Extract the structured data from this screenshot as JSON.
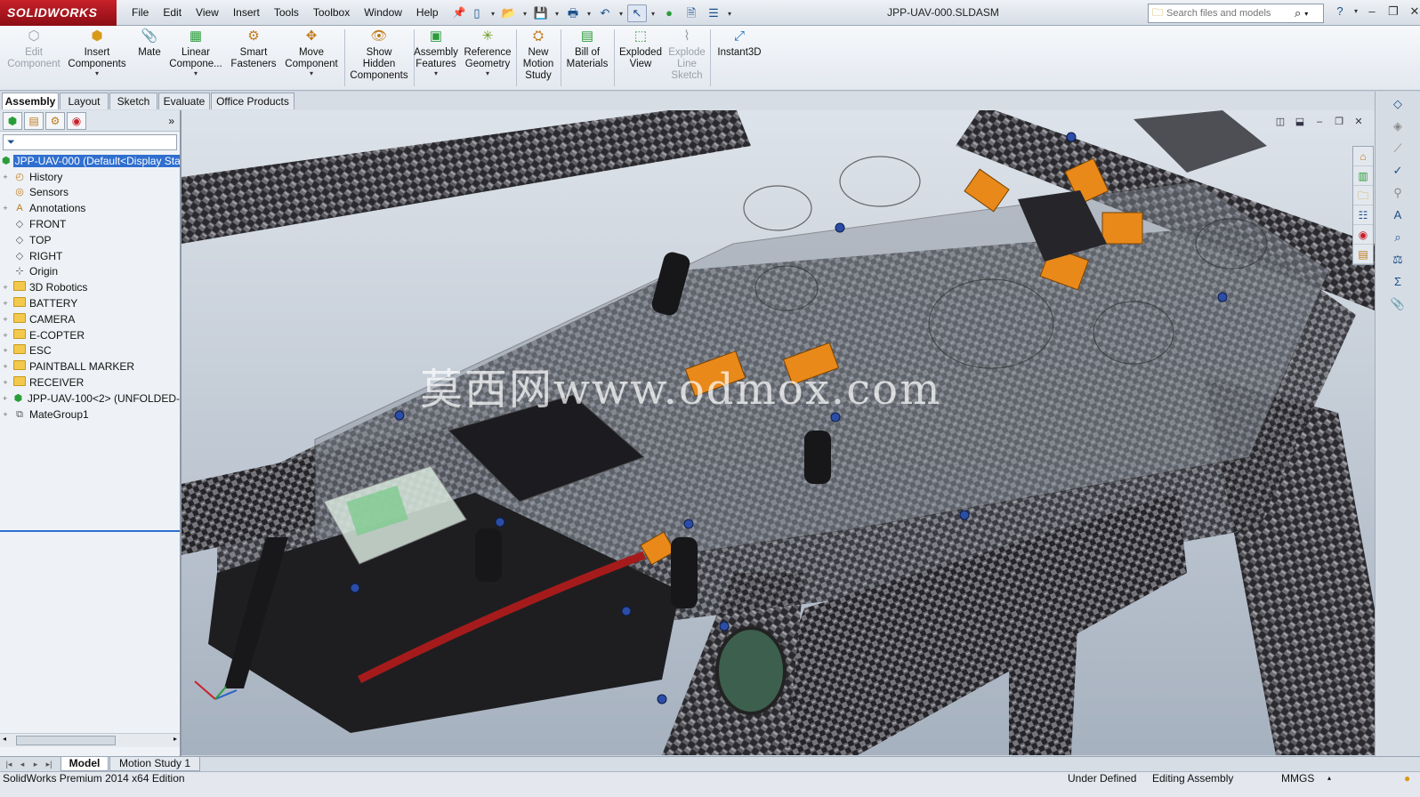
{
  "app": {
    "name": "SOLIDWORKS",
    "document_title": "JPP-UAV-000.SLDASM"
  },
  "menu": [
    "File",
    "Edit",
    "View",
    "Insert",
    "Tools",
    "Toolbox",
    "Window",
    "Help"
  ],
  "search": {
    "placeholder": "Search files and models"
  },
  "ribbon": {
    "edit_component": "Edit\nComponent",
    "insert_components": "Insert\nComponents",
    "mate": "Mate",
    "linear_component": "Linear\nCompone...",
    "smart_fasteners": "Smart\nFasteners",
    "move_component": "Move\nComponent",
    "show_hidden_components": "Show\nHidden\nComponents",
    "assembly_features": "Assembly\nFeatures",
    "reference_geometry": "Reference\nGeometry",
    "new_motion_study": "New\nMotion\nStudy",
    "bill_of_materials": "Bill of\nMaterials",
    "exploded_view": "Exploded\nView",
    "explode_line_sketch": "Explode\nLine\nSketch",
    "instant3d": "Instant3D"
  },
  "command_tabs": [
    "Assembly",
    "Layout",
    "Sketch",
    "Evaluate",
    "Office Products"
  ],
  "feature_tree": [
    {
      "label": "JPP-UAV-000  (Default<Display Sta",
      "icon": "assembly-icon",
      "expander": "",
      "selected": true
    },
    {
      "label": "History",
      "icon": "history-icon",
      "expander": "+"
    },
    {
      "label": "Sensors",
      "icon": "sensor-icon",
      "expander": ""
    },
    {
      "label": "Annotations",
      "icon": "annotation-icon",
      "expander": "+"
    },
    {
      "label": "FRONT",
      "icon": "plane-icon",
      "expander": ""
    },
    {
      "label": "TOP",
      "icon": "plane-icon",
      "expander": ""
    },
    {
      "label": "RIGHT",
      "icon": "plane-icon",
      "expander": ""
    },
    {
      "label": "Origin",
      "icon": "origin-icon",
      "expander": ""
    },
    {
      "label": "3D Robotics",
      "icon": "folder-icon",
      "expander": "+"
    },
    {
      "label": "BATTERY",
      "icon": "folder-icon",
      "expander": "+"
    },
    {
      "label": "CAMERA",
      "icon": "folder-icon",
      "expander": "+"
    },
    {
      "label": "E-COPTER",
      "icon": "folder-icon",
      "expander": "+"
    },
    {
      "label": "ESC",
      "icon": "folder-icon",
      "expander": "+"
    },
    {
      "label": "PAINTBALL MARKER",
      "icon": "folder-icon",
      "expander": "+"
    },
    {
      "label": "RECEIVER",
      "icon": "folder-icon",
      "expander": "+"
    },
    {
      "label": "JPP-UAV-100<2> (UNFOLDED-",
      "icon": "subassembly-icon",
      "expander": "+"
    },
    {
      "label": "MateGroup1",
      "icon": "mates-icon",
      "expander": "+"
    }
  ],
  "viewport": {
    "watermark": "莫西网www.odmox.com"
  },
  "bottom_tabs": [
    "Model",
    "Motion Study 1"
  ],
  "status": {
    "edition": "SolidWorks Premium 2014 x64 Edition",
    "definition": "Under Defined",
    "mode": "Editing Assembly",
    "units": "MMGS"
  },
  "colors": {
    "brand_red": "#c8202a",
    "selection_blue": "#2f6fcf",
    "carbon_dark": "#2a2a2e",
    "connector_orange": "#e8891a"
  }
}
